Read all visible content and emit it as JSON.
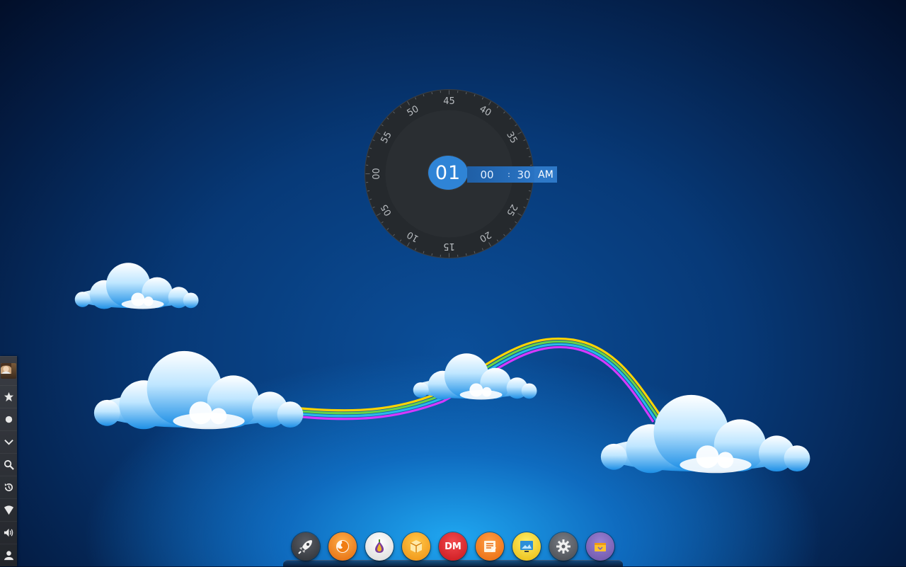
{
  "clock": {
    "hour": "01",
    "minute": "00",
    "separator": ":",
    "second": "30",
    "meridiem": "AM",
    "dial_labels": [
      "45",
      "40",
      "35",
      "30",
      "25",
      "20",
      "15",
      "10",
      "05",
      "00",
      "55",
      "50"
    ]
  },
  "side_panel": {
    "items": [
      {
        "name": "user-avatar",
        "icon": "avatar"
      },
      {
        "name": "favorites",
        "icon": "star-icon"
      },
      {
        "name": "record",
        "icon": "dot-icon"
      },
      {
        "name": "expand",
        "icon": "chevron-down-icon"
      },
      {
        "name": "search",
        "icon": "search-icon"
      },
      {
        "name": "history",
        "icon": "history-icon"
      },
      {
        "name": "wifi",
        "icon": "wifi-icon"
      },
      {
        "name": "volume",
        "icon": "speaker-icon"
      },
      {
        "name": "user",
        "icon": "user-icon"
      }
    ]
  },
  "dock": {
    "items": [
      {
        "name": "launcher",
        "icon": "rocket-icon",
        "color": "#3c3f45"
      },
      {
        "name": "firefox",
        "icon": "firefox-icon",
        "color": "#f07d13"
      },
      {
        "name": "tor-browser",
        "icon": "onion-icon",
        "color": "#f2f2f2"
      },
      {
        "name": "package-manager",
        "icon": "package-icon",
        "color": "#f4a21b"
      },
      {
        "name": "download-manager",
        "icon": "dm-icon",
        "label": "DM",
        "color": "#e0262b"
      },
      {
        "name": "text-editor",
        "icon": "notes-icon",
        "color": "#f07f18"
      },
      {
        "name": "image-viewer",
        "icon": "monitor-icon",
        "color": "#f6d21c"
      },
      {
        "name": "settings",
        "icon": "gear-icon",
        "color": "#5c5f66"
      },
      {
        "name": "store",
        "icon": "store-icon",
        "color": "#7e66b8"
      }
    ]
  },
  "colors": {
    "accent": "#2f84d6",
    "dial": "#24282c",
    "sky_top": "#020f2a",
    "sky_glow": "#1fa6f0"
  }
}
